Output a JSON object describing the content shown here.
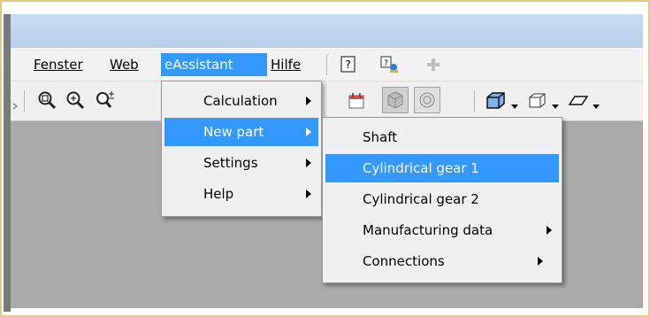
{
  "menubar": {
    "items": [
      {
        "label": "Fenster"
      },
      {
        "label": "Web"
      },
      {
        "label": "eAssistant"
      },
      {
        "label": "Hilfe"
      }
    ]
  },
  "eassistant_menu": {
    "items": [
      {
        "label": "Calculation",
        "submenu": true
      },
      {
        "label": "New part",
        "submenu": true,
        "highlighted": true
      },
      {
        "label": "Settings",
        "submenu": true
      },
      {
        "label": "Help",
        "submenu": true
      }
    ]
  },
  "new_part_submenu": {
    "items": [
      {
        "label": "Shaft",
        "submenu": false
      },
      {
        "label": "Cylindrical gear 1",
        "submenu": false,
        "highlighted": true
      },
      {
        "label": "Cylindrical gear 2",
        "submenu": false
      },
      {
        "label": "Manufacturing data",
        "submenu": true
      },
      {
        "label": "Connections",
        "submenu": true
      }
    ]
  },
  "colors": {
    "highlight": "#3399ff",
    "workspace": "#aaaaaa",
    "titlebar": "#c0d6ee",
    "frame_border": "#e4c98a"
  }
}
